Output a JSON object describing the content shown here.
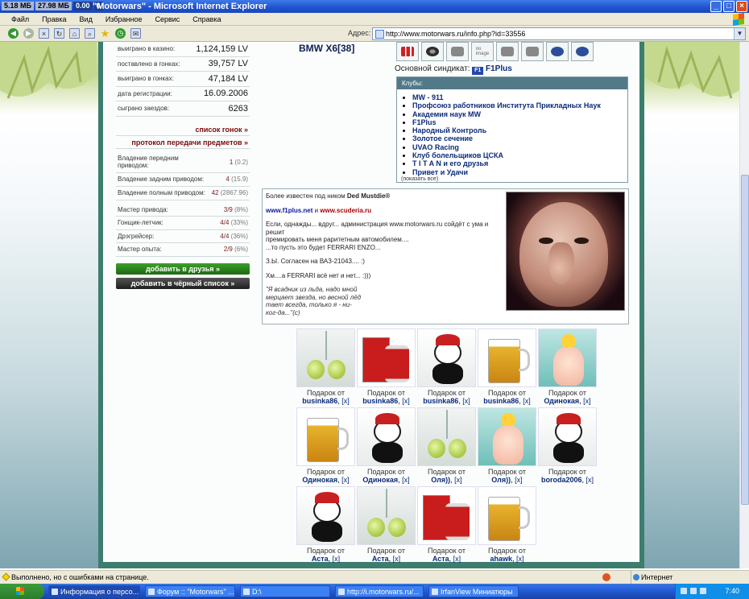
{
  "window": {
    "stats": [
      "5.18 МБ",
      "27.98 МБ",
      "0.00",
      "0"
    ],
    "title": "\"Motorwars\" - Microsoft Internet Explorer"
  },
  "menu": [
    "Файл",
    "Правка",
    "Вид",
    "Избранное",
    "Сервис",
    "Справка"
  ],
  "address": {
    "label": "Адрес:",
    "url": "http://www.motorwars.ru/info.php?id=33556"
  },
  "stats": [
    {
      "label": "выиграно в казино:",
      "value": "1,124,159 LV"
    },
    {
      "label": "поставлено в гонках:",
      "value": "39,757 LV"
    },
    {
      "label": "выиграно в гонках:",
      "value": "47,184 LV"
    },
    {
      "label": "дата регистрации:",
      "value": "16.09.2006"
    },
    {
      "label": "сыграно заездов:",
      "value": "6263"
    }
  ],
  "links": {
    "races": "список гонок »",
    "transfers": "протокол передачи предметов »"
  },
  "ownership": [
    {
      "label": "Владение передним приводом:",
      "value": "1",
      "detail": "(0.2)"
    },
    {
      "label": "Владение задним приводом:",
      "value": "4",
      "detail": "(15.9)"
    },
    {
      "label": "Владение полным приводом:",
      "value": "42",
      "detail": "(2867.96)"
    }
  ],
  "skills": [
    {
      "label": "Мастер привода:",
      "value": "3/9",
      "detail": "(8%)"
    },
    {
      "label": "Гонщик-летчик:",
      "value": "4/4",
      "detail": "(33%)"
    },
    {
      "label": "Дрэгрейсер:",
      "value": "4/4",
      "detail": "(36%)"
    },
    {
      "label": "Мастер опыта:",
      "value": "2/9",
      "detail": "(6%)"
    }
  ],
  "buttons": {
    "add_friend": "добавить в друзья »",
    "add_blacklist": "добавить в чёрный список »"
  },
  "car": "BMW X6[38]",
  "syndicate": {
    "label": "Основной синдикат:",
    "icon_text": "F1",
    "name": "F1Plus"
  },
  "clubs": {
    "header": "Клубы:",
    "items": [
      "MW - 911",
      "Профсоюз работников Института Прикладных Наук",
      "Академия наук MW",
      "F1Plus",
      "Народный Контроль",
      "Золотое сечение",
      "UVAO Racing",
      "Клуб болельщиков ЦСКА",
      "T I T A N и его друзья",
      "Привет и Удачи"
    ],
    "show_all": "(показать все)"
  },
  "bio": {
    "intro_prefix": "Более известен под ником ",
    "nick": "Ded Mustdie®",
    "link1": "www.f1plus.net",
    "and": " и ",
    "link2": "www.scuderia.ru",
    "p1": "Если, однажды... вдруг... администрация www.motorwars.ru сойдёт с ума и решит",
    "p2": "премировать меня раритетным автомобилем....",
    "p3": "...то пусть это будет FERRARI ENZO...",
    "p4": "З.Ы. Согласен на ВАЗ-21043.... :)",
    "p5": "Хм....а FERRARI всё нет и нет... :)))",
    "quote": "\"Я всадник из льда, надо мной мерцает звезда, но весной лёд тает всегда, только я - ни-ког-да...\"(с)"
  },
  "gifts": {
    "caption": "Подарок от",
    "remove": "[x]",
    "items": [
      {
        "type": "balls",
        "from": "businka86"
      },
      {
        "type": "ferrari",
        "from": "businka86"
      },
      {
        "type": "cow",
        "from": "businka86"
      },
      {
        "type": "beer",
        "from": "businka86"
      },
      {
        "type": "doll",
        "from": "Одинокая"
      },
      {
        "type": "beer",
        "from": "Одинокая"
      },
      {
        "type": "cow",
        "from": "Одинокая"
      },
      {
        "type": "balls",
        "from": "Оля))"
      },
      {
        "type": "doll",
        "from": "Оля))"
      },
      {
        "type": "cow",
        "from": "boroda2006"
      },
      {
        "type": "cow",
        "from": "Аста"
      },
      {
        "type": "balls",
        "from": "Аста"
      },
      {
        "type": "ferrari",
        "from": "Аста"
      },
      {
        "type": "beer",
        "from": "ahawk"
      }
    ]
  },
  "status": {
    "message": "Выполнено, но с ошибками на странице.",
    "zone": "Интернет"
  },
  "taskbar": {
    "tasks": [
      "Информация о персо...",
      "Форум :: \"Motorwars\" ...",
      "D:\\",
      "http://i.motorwars.ru/...",
      "IrfanView Миниатюры"
    ],
    "clock": "7:40"
  }
}
